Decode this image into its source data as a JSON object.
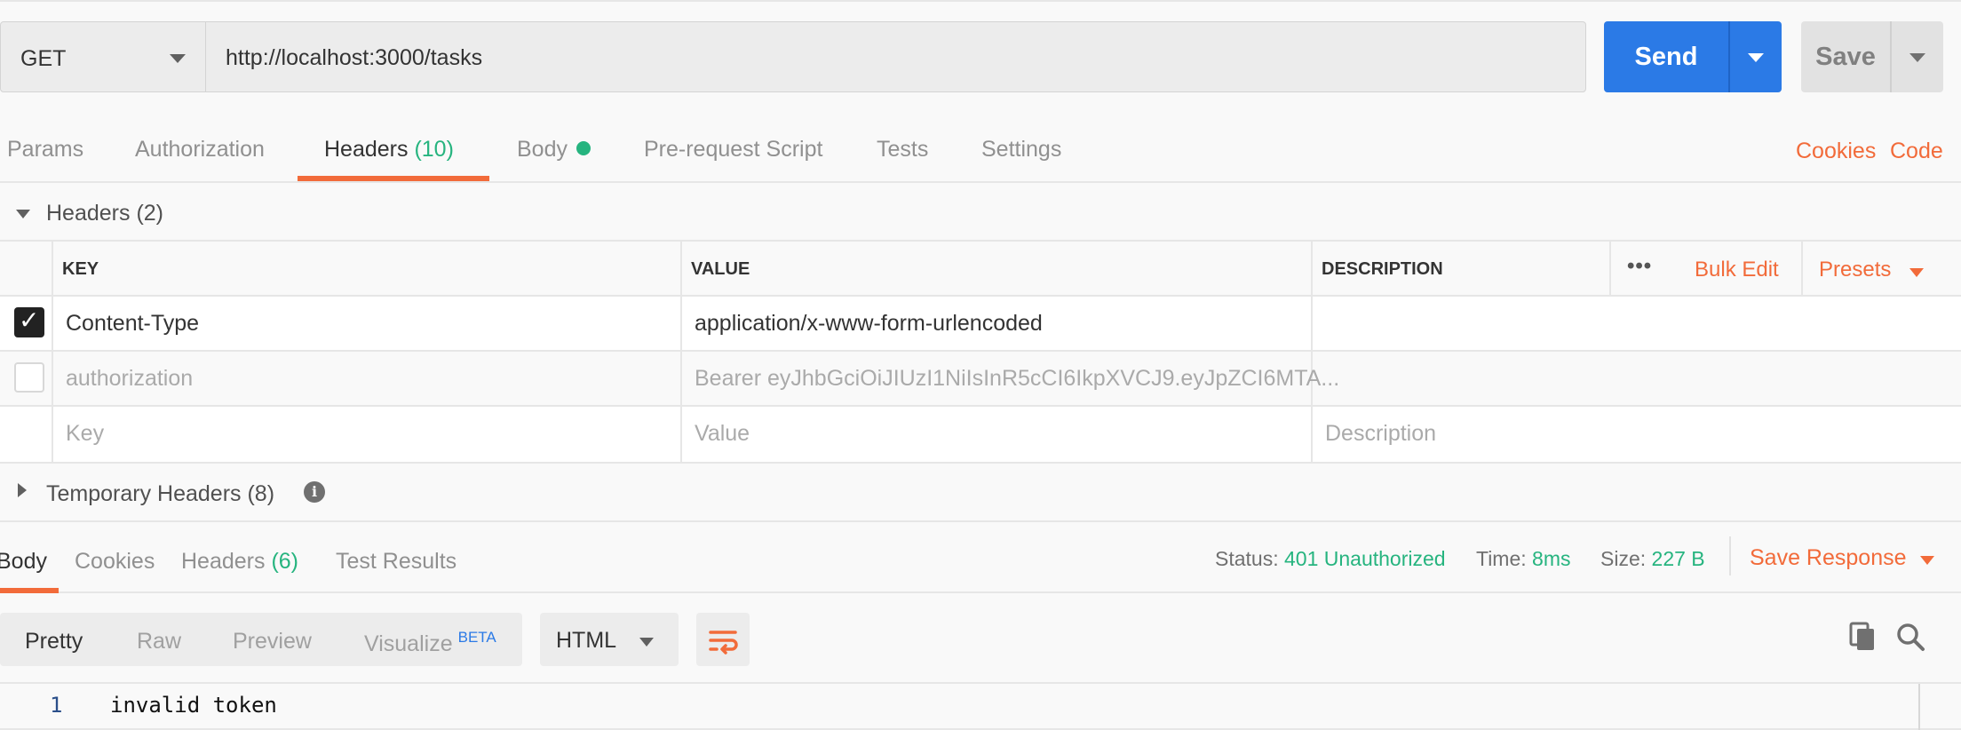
{
  "request": {
    "method": "GET",
    "url": "http://localhost:3000/tasks",
    "send_label": "Send",
    "save_label": "Save"
  },
  "request_tabs": {
    "params": "Params",
    "authorization": "Authorization",
    "headers": "Headers",
    "headers_count": "(10)",
    "body": "Body",
    "prerequest": "Pre-request Script",
    "tests": "Tests",
    "settings": "Settings",
    "cookies_link": "Cookies",
    "code_link": "Code"
  },
  "headers_section": {
    "title": "Headers",
    "count": "(2)",
    "columns": {
      "key": "KEY",
      "value": "VALUE",
      "description": "DESCRIPTION"
    },
    "more_icon": "•••",
    "bulk_edit": "Bulk Edit",
    "presets": "Presets",
    "rows": [
      {
        "checked": true,
        "key": "Content-Type",
        "value": "application/x-www-form-urlencoded",
        "description": ""
      },
      {
        "checked": false,
        "key": "authorization",
        "value": "Bearer eyJhbGciOiJIUzI1NiIsInR5cCI6IkpXVCJ9.eyJpZCI6MTA...",
        "description": ""
      }
    ],
    "placeholder": {
      "key": "Key",
      "value": "Value",
      "description": "Description"
    }
  },
  "temporary_headers": {
    "title": "Temporary Headers",
    "count": "(8)",
    "info": "i"
  },
  "response_tabs": {
    "body": "Body",
    "cookies": "Cookies",
    "headers": "Headers",
    "headers_count": "(6)",
    "test_results": "Test Results"
  },
  "response_status": {
    "status_label": "Status:",
    "status_value": "401 Unauthorized",
    "time_label": "Time:",
    "time_value": "8ms",
    "size_label": "Size:",
    "size_value": "227 B",
    "save_response": "Save Response"
  },
  "body_toolbar": {
    "pretty": "Pretty",
    "raw": "Raw",
    "preview": "Preview",
    "visualize": "Visualize",
    "beta": "BETA",
    "format": "HTML"
  },
  "response_body": {
    "lines": [
      {
        "number": "1",
        "text": "invalid token"
      }
    ]
  },
  "colors": {
    "accent": "#f26b3a",
    "send": "#2b7ae6",
    "success": "#26b47f"
  },
  "icons": [
    "chevron-down-icon",
    "dot-indicator-icon",
    "check-icon",
    "more-icon",
    "info-icon",
    "wrap-lines-icon",
    "copy-icon",
    "search-icon"
  ]
}
